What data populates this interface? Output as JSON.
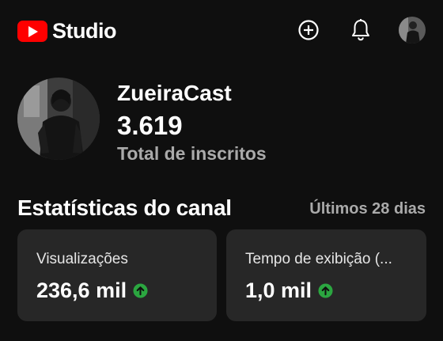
{
  "app": {
    "name": "Studio",
    "brand_color": "#ff0000"
  },
  "topbar": {
    "create_icon": "add-circle-icon",
    "notifications_icon": "bell-icon",
    "account_avatar": "account-avatar"
  },
  "channel": {
    "name": "ZueiraCast",
    "subscribers": "3.619",
    "subscribers_label": "Total de inscritos"
  },
  "stats": {
    "title": "Estatísticas do canal",
    "range": "Últimos 28 dias",
    "cards": [
      {
        "label": "Visualizações",
        "value": "236,6 mil",
        "trend": "up",
        "trend_color": "#2ba640"
      },
      {
        "label": "Tempo de exibição (...",
        "value": "1,0 mil",
        "trend": "up",
        "trend_color": "#2ba640"
      }
    ]
  },
  "colors": {
    "background": "#0f0f0f",
    "card": "#272727",
    "muted_text": "#aaaaaa"
  }
}
